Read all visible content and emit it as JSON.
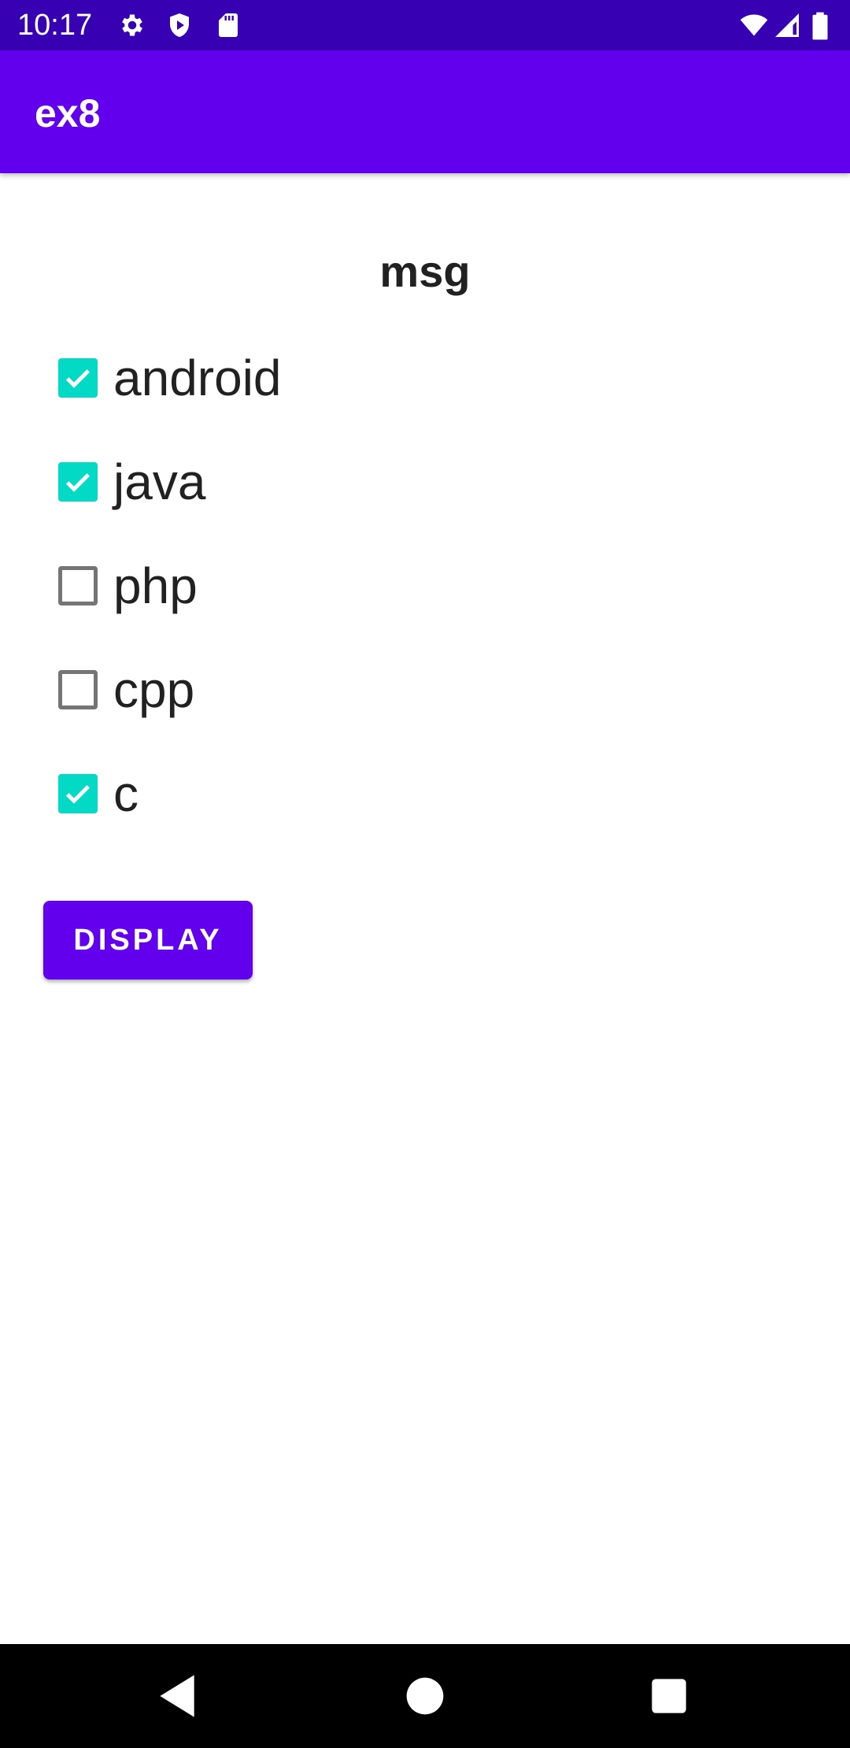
{
  "status_bar": {
    "time": "10:17",
    "left_icons": [
      "settings-icon",
      "play-protect-icon",
      "sd-card-icon"
    ],
    "right_icons": [
      "wifi-icon",
      "signal-icon",
      "battery-icon"
    ],
    "background": "#3700b3"
  },
  "app_bar": {
    "title": "ex8",
    "background": "#6200ee"
  },
  "main": {
    "msg_label": "msg",
    "checkboxes": [
      {
        "label": "android",
        "checked": true
      },
      {
        "label": "java",
        "checked": true
      },
      {
        "label": "php",
        "checked": false
      },
      {
        "label": "cpp",
        "checked": false
      },
      {
        "label": "c",
        "checked": true
      }
    ],
    "checkbox_accent": "#03dac5",
    "display_button_label": "DISPLAY",
    "button_color": "#6200ee"
  },
  "nav_bar": {
    "buttons": [
      "back-icon",
      "home-icon",
      "recents-icon"
    ]
  }
}
